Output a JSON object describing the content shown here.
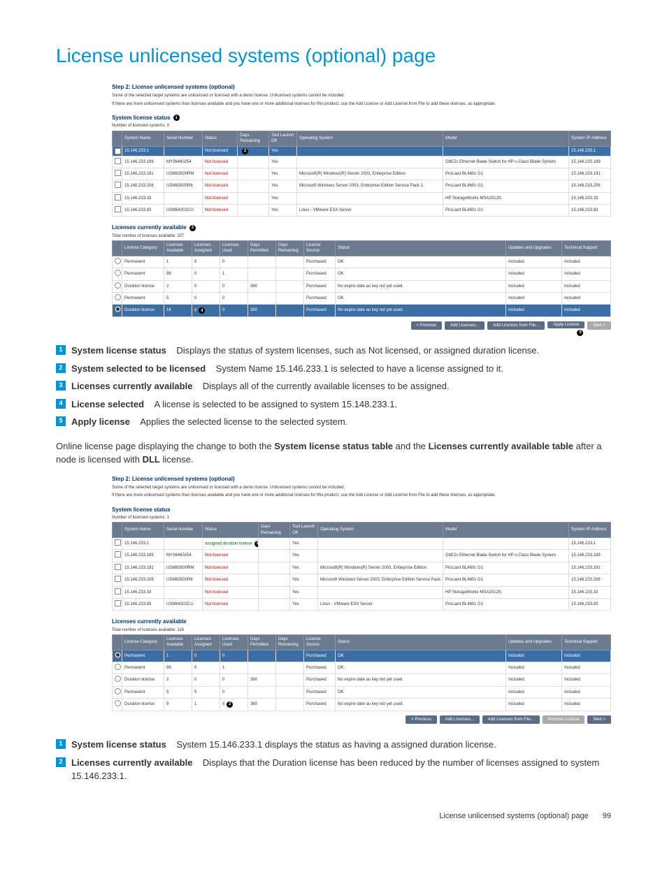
{
  "page": {
    "title": "License unlicensed systems (optional) page",
    "footer_text": "License unlicensed systems (optional) page",
    "page_number": "99"
  },
  "screenshot1": {
    "step_title": "Step 2: License unlicensed systems (optional)",
    "desc1": "Some of the selected target systems are unlicensed or licensed with a demo license. Unlicensed systems cannot be included.",
    "desc2": "If there are more unlicensed systems than licenses available and you have one or more additional licenses for this product, use the Add License or Add License from File to add these licenses, as appropriate.",
    "status_title": "System license status",
    "status_count": "Number of licensed systems: 0",
    "status_headers": [
      "",
      "System Name",
      "Serial Number",
      "Status",
      "Days Remaining",
      "Tool Launch OK",
      "Operating System",
      "Model",
      "System IP Address"
    ],
    "status_rows": [
      {
        "sel": true,
        "cells": [
          "15.146.233.1",
          "",
          "Not licensed",
          "",
          "Yes",
          "",
          "",
          "15.146.233.1"
        ]
      },
      {
        "sel": false,
        "cells": [
          "15.146.233.189",
          "MY36460254",
          "Not licensed",
          "",
          "Yes",
          "",
          "GbE2c Ethernet Blade Switch for HP c-Class Blade System",
          "15.146.233.189"
        ]
      },
      {
        "sel": false,
        "cells": [
          "15.146.233.191",
          "USM63500RM",
          "Not licensed",
          "",
          "Yes",
          "Microsoft(R) Windows(R) Server 2003, Enterprise Edition",
          "ProLiant BL460c G1",
          "15.146.233.191"
        ]
      },
      {
        "sel": false,
        "cells": [
          "15.146.233.206",
          "USM63500R6",
          "Not licensed",
          "",
          "Yes",
          "Microsoft Windows Server 2003, Enterprise Edition Service Pack 1",
          "ProLiant BL460c G1",
          "15.146.233.206"
        ]
      },
      {
        "sel": false,
        "cells": [
          "15.146.233.33",
          "",
          "Not licensed",
          "",
          "Yes",
          "",
          "HP StorageWorks MSA2012fc",
          "15.146.233.33"
        ]
      },
      {
        "sel": false,
        "cells": [
          "15.146.233.83",
          "USM64302CU",
          "Not licensed",
          "",
          "Yes",
          "Linux - VMware ESX Server",
          "ProLiant BL460c G1",
          "15.146.233.83"
        ]
      }
    ],
    "avail_title": "Licenses currently available",
    "avail_count": "Total number of licenses available: 157",
    "avail_headers": [
      "",
      "License Category",
      "Licenses Available",
      "Licenses Assigned",
      "Licenses Used",
      "Days Permitted",
      "Days Remaining",
      "License Source",
      "Status",
      "Updates and Upgrades",
      "Technical Support"
    ],
    "avail_rows": [
      {
        "sel": false,
        "cells": [
          "Permanent",
          "1",
          "0",
          "0",
          "",
          "",
          "Purchased",
          "OK",
          "Included",
          "Included"
        ]
      },
      {
        "sel": false,
        "cells": [
          "Permanent",
          "99",
          "0",
          "1",
          "",
          "",
          "Purchased",
          "OK",
          "Included",
          "Included"
        ]
      },
      {
        "sel": false,
        "cells": [
          "Duration license",
          "2",
          "0",
          "0",
          "360",
          "",
          "Purchased",
          "No expire date as key not yet used.",
          "Included",
          "Included"
        ]
      },
      {
        "sel": false,
        "cells": [
          "Permanent",
          "5",
          "0",
          "0",
          "",
          "",
          "Purchased",
          "OK",
          "Included",
          "Included"
        ]
      },
      {
        "sel": true,
        "cells": [
          "Duration license",
          "16",
          "0",
          "0",
          "360",
          "",
          "Purchased",
          "No expire date as key not yet used.",
          "Included",
          "Included"
        ]
      }
    ],
    "buttons": {
      "prev": "< Previous",
      "add": "Add Licenses...",
      "addfile": "Add Licenses from File...",
      "apply": "Apply License",
      "next": "Next >"
    }
  },
  "callouts1": [
    {
      "n": "1",
      "bold": "System license status",
      "text": "Displays the status of system licenses, such as Not licensed, or assigned duration license."
    },
    {
      "n": "2",
      "bold": "System selected to be licensed",
      "text": "System Name 15.146.233.1 is selected to have a license assigned to it."
    },
    {
      "n": "3",
      "bold": "Licenses currently available",
      "text": "Displays all of the currently available licenses to be assigned."
    },
    {
      "n": "4",
      "bold": "License selected",
      "text": "A license is selected to be assigned to system 15.148.233.1."
    },
    {
      "n": "5",
      "bold": "Apply license",
      "text": "Applies the selected license to the selected system."
    }
  ],
  "bodytext": {
    "p1_a": "Online license page displaying the change to both the ",
    "p1_b": "System license status table",
    "p1_c": " and the ",
    "p1_d": "Licenses currently available table",
    "p1_e": " after a node is licensed with ",
    "p1_f": "DLL",
    "p1_g": " license."
  },
  "screenshot2": {
    "step_title": "Step 2: License unlicensed systems (optional)",
    "desc1": "Some of the selected target systems are unlicensed or licensed with a demo license. Unlicensed systems cannot be included.",
    "desc2": "If there are more unlicensed systems than licenses available and you have one or more additional licenses for this product, use the Add License or Add License from File to add these licenses, as appropriate.",
    "status_title": "System license status",
    "status_count": "Number of licensed systems: 1",
    "status_headers": [
      "",
      "System Name",
      "Serial Number",
      "Status",
      "Days Remaining",
      "Tool Launch OK",
      "Operating System",
      "Model",
      "System IP Address"
    ],
    "status_rows": [
      {
        "sel": false,
        "green": true,
        "cells": [
          "15.146.233.1",
          "",
          "assigned duration license",
          "",
          "Yes",
          "",
          "",
          "15.146.233.1"
        ]
      },
      {
        "sel": false,
        "cells": [
          "15.146.233.189",
          "MY36460254",
          "Not licensed",
          "",
          "Yes",
          "",
          "GbE2c Ethernet Blade Switch for HP c-Class Blade System",
          "15.146.233.189"
        ]
      },
      {
        "sel": false,
        "cells": [
          "15.146.233.191",
          "USM63500RM",
          "Not licensed",
          "",
          "Yes",
          "Microsoft(R) Windows(R) Server 2003, Enterprise Edition",
          "ProLiant BL460c G1",
          "15.146.233.191"
        ]
      },
      {
        "sel": false,
        "cells": [
          "15.146.233.206",
          "USM63500R6",
          "Not licensed",
          "",
          "Yes",
          "Microsoft Windows Server 2003, Enterprise Edition Service Pack 1",
          "ProLiant BL460c G1",
          "15.146.233.206"
        ]
      },
      {
        "sel": false,
        "cells": [
          "15.146.233.33",
          "",
          "Not licensed",
          "",
          "Yes",
          "",
          "HP StorageWorks MSA2012fc",
          "15.146.233.33"
        ]
      },
      {
        "sel": false,
        "cells": [
          "15.146.233.83",
          "USM64302CU",
          "Not licensed",
          "",
          "Yes",
          "Linux - VMware ESX Server",
          "ProLiant BL460c G1",
          "15.146.233.83"
        ]
      }
    ],
    "avail_title": "Licenses currently available",
    "avail_count": "Total number of licenses available: 116",
    "avail_headers": [
      "",
      "License Category",
      "Licenses Available",
      "Licenses Assigned",
      "Licenses Used",
      "Days Permitted",
      "Days Remaining",
      "License Source",
      "Status",
      "Updates and Upgrades",
      "Technical Support"
    ],
    "avail_rows": [
      {
        "sel": true,
        "cells": [
          "Permanent",
          "1",
          "0",
          "0",
          "",
          "",
          "Purchased",
          "OK",
          "Included",
          "Included"
        ]
      },
      {
        "sel": false,
        "cells": [
          "Permanent",
          "99",
          "0",
          "1",
          "",
          "",
          "Purchased",
          "OK",
          "Included",
          "Included"
        ]
      },
      {
        "sel": false,
        "cells": [
          "Duration license",
          "2",
          "0",
          "0",
          "360",
          "",
          "Purchased",
          "No expire date as key not yet used.",
          "Included",
          "Included"
        ]
      },
      {
        "sel": false,
        "cells": [
          "Permanent",
          "5",
          "0",
          "0",
          "",
          "",
          "Purchased",
          "OK",
          "Included",
          "Included"
        ]
      },
      {
        "sel": false,
        "cells": [
          "Duration license",
          "9",
          "1",
          "0",
          "360",
          "",
          "Purchased",
          "No expire date as key not yet used.",
          "Included",
          "Included"
        ]
      }
    ],
    "buttons": {
      "prev": "< Previous",
      "add": "Add Licenses...",
      "addfile": "Add Licenses from File...",
      "remove": "Remove License",
      "next": "Next >"
    }
  },
  "callouts2": [
    {
      "n": "1",
      "bold": "System license status",
      "text": "System 15.146.233.1 displays the status as having a assigned duration license."
    },
    {
      "n": "2",
      "bold": "Licenses currently available",
      "text": "Displays that the Duration license has been reduced by the number of licenses assigned to system 15.146.233.1."
    }
  ],
  "callout_markers1": {
    "c1": "1",
    "c2": "2",
    "c3": "3",
    "c4": "4",
    "c5": "5"
  },
  "callout_markers2": {
    "c1": "1",
    "c2": "2"
  }
}
